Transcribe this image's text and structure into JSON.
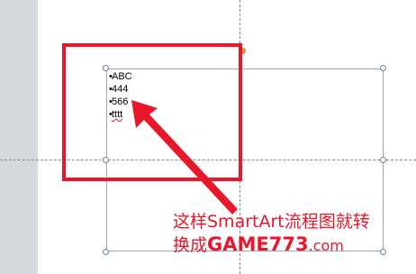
{
  "slide": {
    "bullets": [
      {
        "text": "ABC"
      },
      {
        "text": "444"
      },
      {
        "text": "566"
      },
      {
        "text": "tttt",
        "spell_error": true
      }
    ]
  },
  "caption": {
    "line1": "这样SmartArt流程图就转",
    "line2_prefix": "换成",
    "line2_brand": "GAME773",
    "line2_suffix": ".com"
  },
  "colors": {
    "annotation": "#e8172a",
    "frame": "#9aa7b6",
    "rotation_handle": "#f0a640"
  },
  "icons": {
    "arrow": "red-arrow-icon"
  }
}
